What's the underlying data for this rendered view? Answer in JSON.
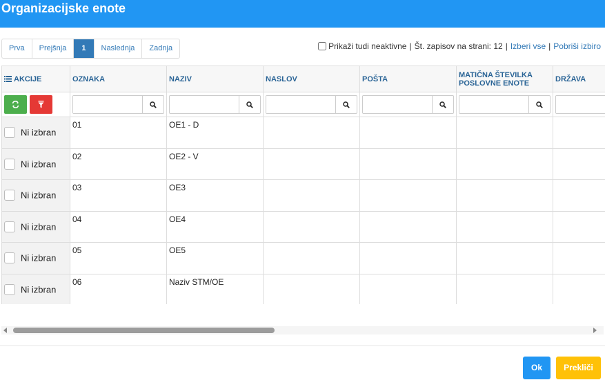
{
  "title": "Organizacijske enote",
  "pager": {
    "first": "Prva",
    "prev": "Prejšnja",
    "current": "1",
    "next": "Naslednja",
    "last": "Zadnja"
  },
  "options": {
    "show_inactive": "Prikaži tudi neaktivne",
    "records_label": "Št. zapisov na strani: 12",
    "select_all": "Izberi vse",
    "clear_selection": "Pobriši izbiro",
    "separator": "|"
  },
  "columns": {
    "akcije": "AKCIJE",
    "oznaka": "OZNAKA",
    "naziv": "NAZIV",
    "naslov": "NASLOV",
    "posta": "POŠTA",
    "maticna_1": "MATIČNA ŠTEVILKA",
    "maticna_2": "POSLOVNE ENOTE",
    "drzava": "DRŽAVA"
  },
  "rows": [
    {
      "select": "Ni izbran",
      "oznaka": "01",
      "naziv": "OE1 - D"
    },
    {
      "select": "Ni izbran",
      "oznaka": "02",
      "naziv": "OE2 - V"
    },
    {
      "select": "Ni izbran",
      "oznaka": "03",
      "naziv": "OE3"
    },
    {
      "select": "Ni izbran",
      "oznaka": "04",
      "naziv": "OE4"
    },
    {
      "select": "Ni izbran",
      "oznaka": "05",
      "naziv": "OE5"
    },
    {
      "select": "Ni izbran",
      "oznaka": "06",
      "naziv": "Naziv STM/OE"
    }
  ],
  "footer": {
    "ok": "Ok",
    "cancel": "Prekliči"
  },
  "colors": {
    "header": "#2196f3",
    "refresh": "#4cae4c",
    "clear_filter": "#e53935",
    "ok": "#2196f3",
    "cancel": "#ffc107"
  }
}
